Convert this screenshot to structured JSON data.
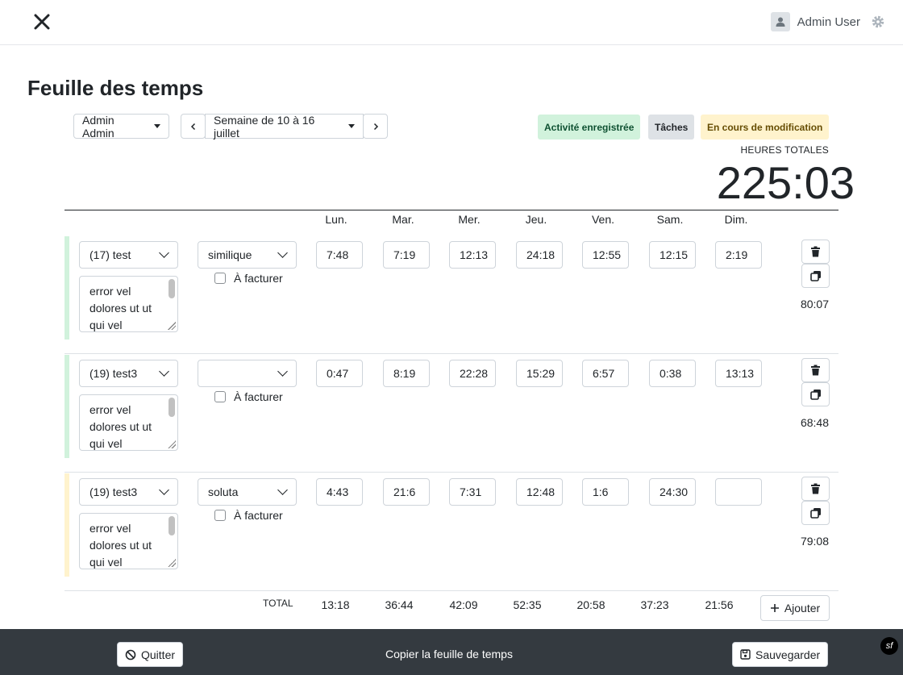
{
  "topbar": {
    "user_name": "Admin User"
  },
  "page": {
    "title": "Feuille des temps"
  },
  "controls": {
    "employee": "Admin Admin",
    "week": "Semaine de 10 à 16 juillet"
  },
  "legend": {
    "items": [
      {
        "label": "Activité enregistrée",
        "bg": "#d1f2dc",
        "color": "#0f5132"
      },
      {
        "label": "Tâches",
        "bg": "#dee2e6",
        "color": "#212529"
      },
      {
        "label": "En cours de modification",
        "bg": "#fff3cd",
        "color": "#664d03"
      }
    ]
  },
  "summary": {
    "label": "HEURES TOTALES",
    "value": "225:03"
  },
  "days": [
    "Lun.",
    "Mar.",
    "Mer.",
    "Jeu.",
    "Ven.",
    "Sam.",
    "Dim."
  ],
  "rows": [
    {
      "project": "(17) test",
      "task": "similique",
      "description": "error vel dolores ut ut qui vel",
      "billable_label": "À facturer",
      "times": [
        "7:48",
        "7:19",
        "12:13",
        "24:18",
        "12:55",
        "12:15",
        "2:19"
      ],
      "total": "80:07",
      "accent": "#d1f2dc"
    },
    {
      "project": "(19) test3",
      "task": "",
      "description": "error vel dolores ut ut qui vel",
      "billable_label": "À facturer",
      "times": [
        "0:47",
        "8:19",
        "22:28",
        "15:29",
        "6:57",
        "0:38",
        "13:13"
      ],
      "total": "68:48",
      "accent": "#d1f2dc"
    },
    {
      "project": "(19) test3",
      "task": "soluta",
      "description": "error vel dolores ut ut qui vel",
      "billable_label": "À facturer",
      "times": [
        "4:43",
        "21:6",
        "7:31",
        "12:48",
        "1:6",
        "24:30",
        ""
      ],
      "total": "79:08",
      "accent": "#fff3cd"
    }
  ],
  "totals": {
    "label": "TOTAL",
    "values": [
      "13:18",
      "36:44",
      "42:09",
      "52:35",
      "20:58",
      "37:23",
      "21:56"
    ],
    "add_label": "Ajouter"
  },
  "footer": {
    "quit_label": "Quitter",
    "copy_label": "Copier la feuille de temps",
    "save_label": "Sauvegarder",
    "badge": "sf"
  }
}
